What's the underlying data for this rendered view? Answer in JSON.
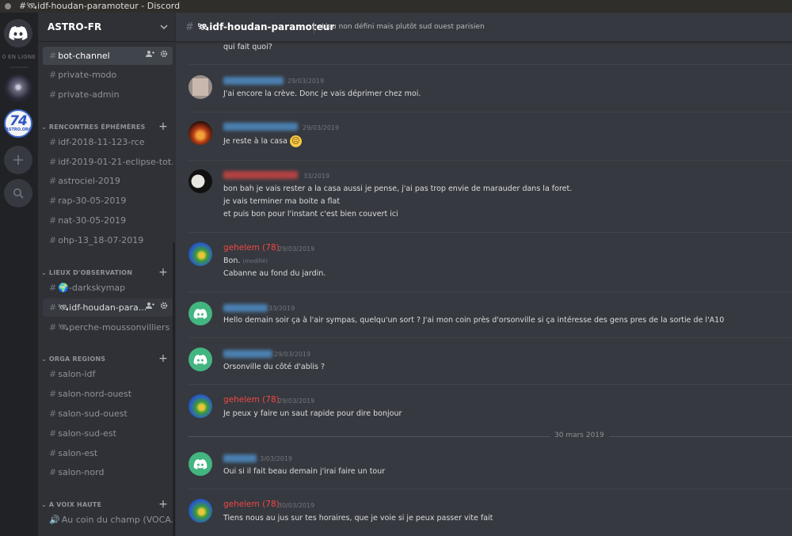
{
  "window": {
    "title": "#🛰idf-houdan-paramoteur - Discord"
  },
  "guilds": {
    "online_label": "0 EN LIGNE",
    "num_logo": "74",
    "sub_logo": "ASTRO.ORG"
  },
  "server": {
    "name": "ASTRO-FR"
  },
  "channels_top": [
    "bot-channel",
    "private-modo",
    "private-admin"
  ],
  "categories": {
    "rencontres": "RENCONTRES ÉPHÉMÈRES",
    "lieux": "LIEUX D'OBSERVATION",
    "orga": "ORGA REGIONS",
    "voix": "A VOIX HAUTE"
  },
  "channels_rencontres": [
    "idf-2018-11-123-rce",
    "idf-2019-01-21-eclipse-tot...",
    "astrociel-2019",
    "rap-30-05-2019",
    "nat-30-05-2019",
    "ohp-13_18-07-2019"
  ],
  "channels_lieux": [
    "🌍-darkskymap",
    "🛰idf-houdan-para...",
    "🛰perche-moussonvilliers"
  ],
  "channels_orga": [
    "salon-idf",
    "salon-nord-ouest",
    "salon-sud-ouest",
    "salon-sud-est",
    "salon-est",
    "salon-nord"
  ],
  "channels_voix": [
    "Au coin du champ (VOCA..."
  ],
  "channel": {
    "name": "🛰idf-houdan-paramoteur",
    "topic": "Lieu non défini mais plutôt sud ouest parisien"
  },
  "messages": {
    "m0": {
      "line1": "qui fait quoi?"
    },
    "m1": {
      "ts": "29/03/2019",
      "line1": "J'ai encore la crève. Donc je vais déprimer chez moi."
    },
    "m2": {
      "ts": "29/03/2019",
      "line1": "Je reste à la casa",
      "emoji": "☹"
    },
    "m3": {
      "ts": "33/2019",
      "line1": "bon bah je vais rester a la casa aussi je pense, j'ai pas trop envie de marauder dans la foret.",
      "line2": "je vais terminer ma boite a flat",
      "line3": "et puis bon pour l'instant c'est bien couvert ici"
    },
    "m4": {
      "user": "gehelem (78)",
      "ts": "29/03/2019",
      "line1": "Bon.",
      "edited": "(modifié)",
      "line2": "Cabanne au fond du jardin."
    },
    "m5": {
      "ts": "33/2019",
      "line1": "Hello demain soir ça à l'air sympas, quelqu'un sort ?  J'ai mon coin près d'orsonville si ça intéresse des gens  pres de la sortie de l'A10"
    },
    "m6": {
      "ts": "29/03/2019",
      "line1": "Orsonville du côté d'ablis ?"
    },
    "m7": {
      "user": "gehelem (78)",
      "ts": "29/03/2019",
      "line1": "Je peux y faire un saut rapide pour dire bonjour"
    },
    "date_divider": "30 mars 2019",
    "m8": {
      "ts": "3/03/2019",
      "line1": "Oui si il fait beau demain j'irai faire un tour"
    },
    "m9": {
      "user": "gehelem (78)",
      "ts": "30/03/2019",
      "line1": "Tiens nous au jus sur tes horaires, que je voie si je peux passer vite fait"
    }
  }
}
